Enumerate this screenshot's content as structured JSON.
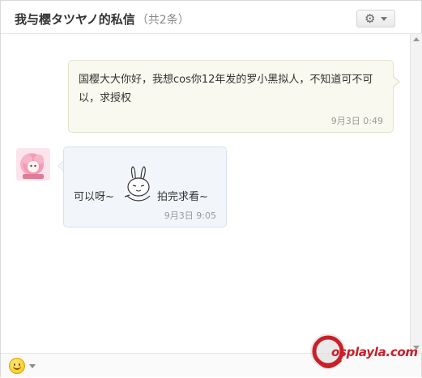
{
  "header": {
    "title": "我与樱タツヤノ的私信",
    "count": "（共2条）",
    "settings_icon": "gear-icon"
  },
  "messages": [
    {
      "direction": "outgoing",
      "text": "国樱大大你好，我想cos你12年发的罗小黑拟人，不知道可不可以，求授权",
      "time": "9月3日 0:49"
    },
    {
      "direction": "incoming",
      "avatar_icon": "user-avatar",
      "text_before": "可以呀~",
      "emoticon": "rabbit-emoticon",
      "text_after": "拍完求看~",
      "time": "9月3日 9:05"
    }
  ],
  "footer": {
    "emoji_icon": "smiley-icon"
  },
  "watermark": {
    "text": "osplayla.com"
  },
  "colors": {
    "outgoing_bubble": "#f9f9ef",
    "incoming_bubble": "#f2f6fb",
    "watermark_red": "#c8202a"
  }
}
